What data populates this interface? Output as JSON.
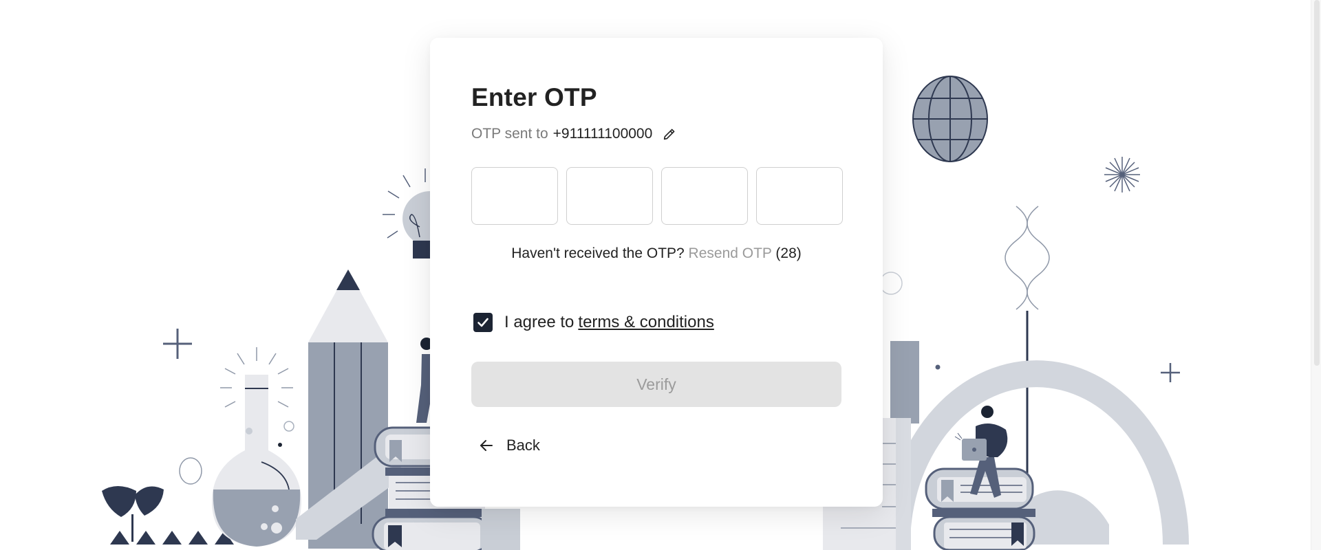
{
  "otp": {
    "title": "Enter OTP",
    "sent_label": "OTP sent to",
    "phone": "+911111100000",
    "digits": [
      "",
      "",
      "",
      ""
    ],
    "resend_prompt": "Haven't received the OTP?",
    "resend_link": "Resend OTP",
    "countdown": "(28)",
    "agree_text": "I agree to",
    "terms_link": "terms & conditions",
    "terms_checked": true,
    "verify_label": "Verify",
    "back_label": "Back"
  },
  "icons": {
    "edit": "pencil-icon",
    "check": "checkmark-icon",
    "back": "arrow-left-icon"
  },
  "colors": {
    "checkbox": "#1c2433",
    "verify_disabled_bg": "#e3e3e3",
    "muted_text": "#7a7a7a",
    "link_muted": "#9a9a9a",
    "illustration": "#98a1b0"
  }
}
